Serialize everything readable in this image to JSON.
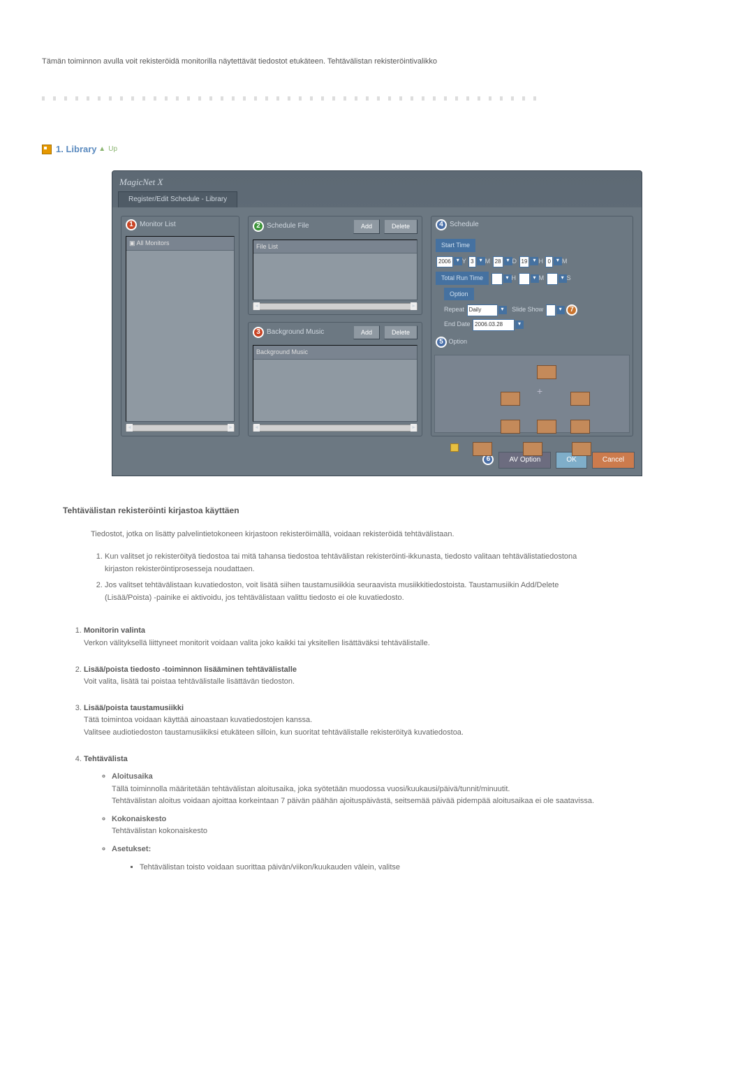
{
  "intro": "Tämän toiminnon avulla voit rekisteröidä monitorilla näytettävät tiedostot etukäteen. Tehtävälistan rekisteröintivalikko",
  "section": {
    "title": "1. Library",
    "up": "Up"
  },
  "ss": {
    "window_title": "MagicNet X",
    "tab": "Register/Edit Schedule - Library",
    "n1": "1",
    "n2": "2",
    "n3": "3",
    "n4": "4",
    "n5": "5",
    "n6": "6",
    "n7": "7",
    "monitor_list": "Monitor List",
    "all_monitors": "All Monitors",
    "schedule_file": "Schedule File",
    "add": "Add",
    "delete": "Delete",
    "file_list": "File List",
    "bg_music": "Background Music",
    "bg_music_head": "Background Music",
    "schedule": "Schedule",
    "start_time": "Start Time",
    "year": "2006",
    "y": "Y",
    "mon": "3",
    "ml": "M",
    "day": "28",
    "dl": "D",
    "hour": "19",
    "hl": "H",
    "min": "0",
    "minl": "M",
    "total_run": "Total Run Time",
    "run_h": "H",
    "run_m": "M",
    "run_s": "S",
    "option": "Option",
    "repeat": "Repeat",
    "daily": "Daily",
    "slide": "Slide Show",
    "end_date": "End Date",
    "end_date_val": "2006.03.28",
    "option5": "Option",
    "av_option": "AV Option",
    "ok": "OK",
    "cancel": "Cancel"
  },
  "sub_heading": "Tehtävälistan rekisteröinti kirjastoa käyttäen",
  "body1": "Tiedostot, jotka on lisätty palvelintietokoneen kirjastoon rekisteröimällä, voidaan rekisteröidä tehtävälistaan.",
  "numlist": [
    "Kun valitset jo rekisteröityä tiedostoa tai mitä tahansa tiedostoa tehtävälistan rekisteröinti-ikkunasta, tiedosto valitaan tehtävälistatiedostona kirjaston rekisteröintiprosesseja noudattaen.",
    "Jos valitset tehtävälistaan kuvatiedoston, voit lisätä siihen taustamusiikkia seuraavista musiikkitiedostoista. Taustamusiikin Add/Delete (Lisää/Poista) -painike ei aktivoidu, jos tehtävälistaan valittu tiedosto ei ole kuvatiedosto."
  ],
  "outer": {
    "i1": {
      "t": "Monitorin valinta",
      "d": "Verkon välityksellä liittyneet monitorit voidaan valita joko kaikki tai yksitellen lisättäväksi tehtävälistalle."
    },
    "i2": {
      "t": "Lisää/poista tiedosto -toiminnon lisääminen tehtävälistalle",
      "d": "Voit valita, lisätä tai poistaa tehtävälistalle lisättävän tiedoston."
    },
    "i3": {
      "t": "Lisää/poista taustamusiikki",
      "d1": "Tätä toimintoa voidaan käyttää ainoastaan kuvatiedostojen kanssa.",
      "d2": "Valitsee audiotiedoston taustamusiikiksi etukäteen silloin, kun suoritat tehtävälistalle rekisteröityä kuvatiedostoa."
    },
    "i4": {
      "t": "Tehtävälista",
      "alo_t": "Aloitusaika",
      "alo_d1": "Tällä toiminnolla määritetään tehtävälistan aloitusaika, joka syötetään muodossa vuosi/kuukausi/päivä/tunnit/minuutit.",
      "alo_d2": "Tehtävälistan aloitus voidaan ajoittaa korkeintaan 7 päivän päähän ajoituspäivästä, seitsemää päivää pidempää aloitusaikaa ei ole saatavissa.",
      "kok_t": "Kokonaiskesto",
      "kok_d": "Tehtävälistan kokonaiskesto",
      "ase_t": "Asetukset:",
      "ase_b1": "Tehtävälistan toisto voidaan suorittaa päivän/viikon/kuukauden välein, valitse"
    }
  }
}
